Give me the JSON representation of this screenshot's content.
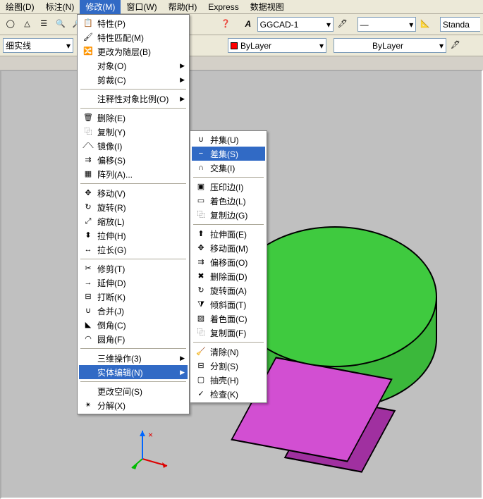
{
  "menubar": {
    "items": [
      "绘图(D)",
      "标注(N)",
      "修改(M)",
      "窗口(W)",
      "帮助(H)",
      "Express",
      "数据视图"
    ],
    "active_index": 2
  },
  "tool_row1": {
    "line_combo": "细实线",
    "style_combo": "GGCAD-1",
    "lineweight_combo": "—",
    "textstyle_combo": "Standa"
  },
  "tool_row2": {
    "layer_color": "#ff0000",
    "layer_combo": "ByLayer",
    "linetype_combo": "ByLayer"
  },
  "icons": {
    "props": "📋",
    "match": "🖌",
    "random": "🔀",
    "object": "对象",
    "clip": "剪裁",
    "annot": "注释性对象比例",
    "erase": "🗑",
    "copy": "⿻",
    "mirror": "⟋⟍",
    "offset": "⇉",
    "array": "▦",
    "move": "✥",
    "rotate": "↻",
    "scale": "⤢",
    "stretch": "⬍",
    "lengthen": "↔",
    "trim": "✂",
    "extend": "→",
    "break": "⊟",
    "join": "∪",
    "chamfer": "◣",
    "fillet": "◠",
    "3dop": "三维操作",
    "solidedit": "实体编辑",
    "space": "更改空间",
    "explode": "✴",
    "union": "∪",
    "subtract": "−",
    "intersect": "∩",
    "imprint": "▣",
    "coloredge": "▭",
    "copyedge": "⿻",
    "extrude": "⬆",
    "moveface": "✥",
    "offsetface": "⇉",
    "deleteface": "✖",
    "rotateface": "↻",
    "taperface": "⧩",
    "colorface": "▨",
    "copyface": "⿻",
    "clean": "🧹",
    "separate": "⊟",
    "shell": "▢",
    "check": "✓"
  },
  "menu1": [
    {
      "t": "row",
      "icon": "props",
      "label": "特性(P)"
    },
    {
      "t": "row",
      "icon": "match",
      "label": "特性匹配(M)"
    },
    {
      "t": "row",
      "icon": "random",
      "label": "更改为随层(B)"
    },
    {
      "t": "row",
      "sub": true,
      "label": "对象(O)"
    },
    {
      "t": "row",
      "sub": true,
      "label": "剪裁(C)"
    },
    {
      "t": "sep"
    },
    {
      "t": "row",
      "sub": true,
      "label": "注释性对象比例(O)"
    },
    {
      "t": "sep"
    },
    {
      "t": "row",
      "icon": "erase",
      "label": "删除(E)"
    },
    {
      "t": "row",
      "icon": "copy",
      "label": "复制(Y)"
    },
    {
      "t": "row",
      "icon": "mirror",
      "label": "镜像(I)"
    },
    {
      "t": "row",
      "icon": "offset",
      "label": "偏移(S)"
    },
    {
      "t": "row",
      "icon": "array",
      "label": "阵列(A)..."
    },
    {
      "t": "sep"
    },
    {
      "t": "row",
      "icon": "move",
      "label": "移动(V)"
    },
    {
      "t": "row",
      "icon": "rotate",
      "label": "旋转(R)"
    },
    {
      "t": "row",
      "icon": "scale",
      "label": "缩放(L)"
    },
    {
      "t": "row",
      "icon": "stretch",
      "label": "拉伸(H)"
    },
    {
      "t": "row",
      "icon": "lengthen",
      "label": "拉长(G)"
    },
    {
      "t": "sep"
    },
    {
      "t": "row",
      "icon": "trim",
      "label": "修剪(T)"
    },
    {
      "t": "row",
      "icon": "extend",
      "label": "延伸(D)"
    },
    {
      "t": "row",
      "icon": "break",
      "label": "打断(K)"
    },
    {
      "t": "row",
      "icon": "join",
      "label": "合并(J)"
    },
    {
      "t": "row",
      "icon": "chamfer",
      "label": "倒角(C)"
    },
    {
      "t": "row",
      "icon": "fillet",
      "label": "圆角(F)"
    },
    {
      "t": "sep"
    },
    {
      "t": "row",
      "sub": true,
      "label": "三维操作(3)"
    },
    {
      "t": "row",
      "sub": true,
      "hl": true,
      "label": "实体编辑(N)"
    },
    {
      "t": "sep"
    },
    {
      "t": "row",
      "label": "更改空间(S)"
    },
    {
      "t": "row",
      "icon": "explode",
      "label": "分解(X)"
    }
  ],
  "menu2": [
    {
      "t": "row",
      "icon": "union",
      "label": "并集(U)"
    },
    {
      "t": "row",
      "icon": "subtract",
      "hl": true,
      "label": "差集(S)"
    },
    {
      "t": "row",
      "icon": "intersect",
      "label": "交集(I)"
    },
    {
      "t": "sep"
    },
    {
      "t": "row",
      "icon": "imprint",
      "label": "压印边(I)"
    },
    {
      "t": "row",
      "icon": "coloredge",
      "label": "着色边(L)"
    },
    {
      "t": "row",
      "icon": "copyedge",
      "label": "复制边(G)"
    },
    {
      "t": "sep"
    },
    {
      "t": "row",
      "icon": "extrude",
      "label": "拉伸面(E)"
    },
    {
      "t": "row",
      "icon": "moveface",
      "label": "移动面(M)"
    },
    {
      "t": "row",
      "icon": "offsetface",
      "label": "偏移面(O)"
    },
    {
      "t": "row",
      "icon": "deleteface",
      "label": "删除面(D)"
    },
    {
      "t": "row",
      "icon": "rotateface",
      "label": "旋转面(A)"
    },
    {
      "t": "row",
      "icon": "taperface",
      "label": "倾斜面(T)"
    },
    {
      "t": "row",
      "icon": "colorface",
      "label": "着色面(C)"
    },
    {
      "t": "row",
      "icon": "copyface",
      "label": "复制面(F)"
    },
    {
      "t": "sep"
    },
    {
      "t": "row",
      "icon": "clean",
      "label": "清除(N)"
    },
    {
      "t": "row",
      "icon": "separate",
      "label": "分割(S)"
    },
    {
      "t": "row",
      "icon": "shell",
      "label": "抽壳(H)"
    },
    {
      "t": "row",
      "icon": "check",
      "label": "检查(K)"
    }
  ]
}
